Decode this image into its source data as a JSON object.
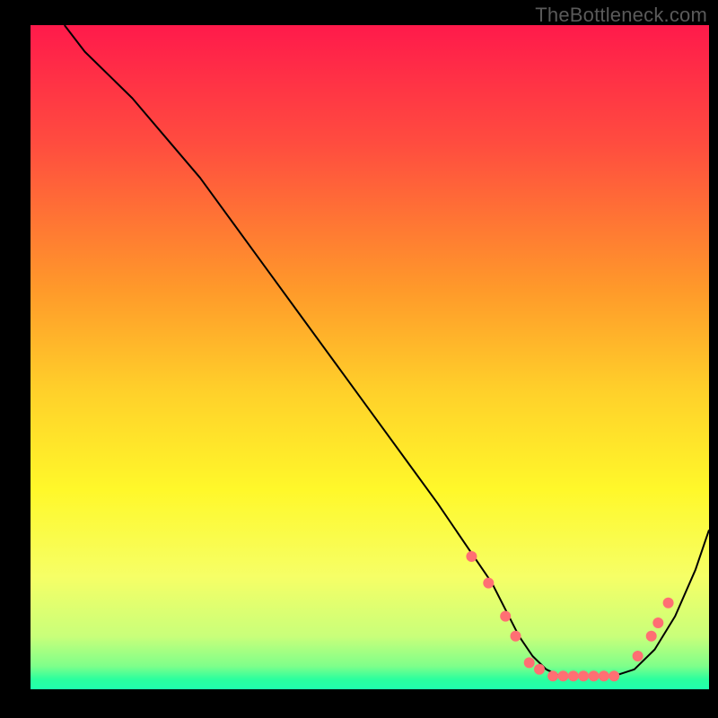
{
  "watermark": "TheBottleneck.com",
  "chart_data": {
    "type": "line",
    "title": "",
    "xlabel": "",
    "ylabel": "",
    "xlim": [
      0,
      100
    ],
    "ylim": [
      0,
      100
    ],
    "grid": false,
    "legend": false,
    "background_gradient": {
      "direction": "top-to-bottom",
      "stops": [
        {
          "offset": 0.0,
          "color": "#ff1a4b"
        },
        {
          "offset": 0.18,
          "color": "#ff4d3f"
        },
        {
          "offset": 0.4,
          "color": "#ff9a2a"
        },
        {
          "offset": 0.55,
          "color": "#ffd02a"
        },
        {
          "offset": 0.7,
          "color": "#fff82a"
        },
        {
          "offset": 0.83,
          "color": "#f6ff66"
        },
        {
          "offset": 0.92,
          "color": "#c9ff7a"
        },
        {
          "offset": 0.965,
          "color": "#7fff8a"
        },
        {
          "offset": 0.985,
          "color": "#2bff9e"
        },
        {
          "offset": 1.0,
          "color": "#1fffae"
        }
      ]
    },
    "series": [
      {
        "name": "curve",
        "color": "#000000",
        "stroke_width": 2,
        "x": [
          5,
          8,
          10,
          15,
          20,
          25,
          30,
          35,
          40,
          45,
          50,
          55,
          60,
          62,
          64,
          66,
          68,
          70,
          72,
          74,
          76,
          78,
          80,
          82,
          84,
          86,
          89,
          92,
          95,
          98,
          100
        ],
        "y": [
          100,
          96,
          94,
          89,
          83,
          77,
          70,
          63,
          56,
          49,
          42,
          35,
          28,
          25,
          22,
          19,
          16,
          12,
          8,
          5,
          3,
          2,
          2,
          2,
          2,
          2,
          3,
          6,
          11,
          18,
          24
        ]
      }
    ],
    "markers": {
      "name": "highlight-points",
      "color": "#ff6f73",
      "radius": 6,
      "points": [
        {
          "x": 65.0,
          "y": 20
        },
        {
          "x": 67.5,
          "y": 16
        },
        {
          "x": 70.0,
          "y": 11
        },
        {
          "x": 71.5,
          "y": 8
        },
        {
          "x": 73.5,
          "y": 4
        },
        {
          "x": 75.0,
          "y": 3
        },
        {
          "x": 77.0,
          "y": 2
        },
        {
          "x": 78.5,
          "y": 2
        },
        {
          "x": 80.0,
          "y": 2
        },
        {
          "x": 81.5,
          "y": 2
        },
        {
          "x": 83.0,
          "y": 2
        },
        {
          "x": 84.5,
          "y": 2
        },
        {
          "x": 86.0,
          "y": 2
        },
        {
          "x": 89.5,
          "y": 5
        },
        {
          "x": 91.5,
          "y": 8
        },
        {
          "x": 92.5,
          "y": 10
        },
        {
          "x": 94.0,
          "y": 13
        }
      ]
    }
  }
}
